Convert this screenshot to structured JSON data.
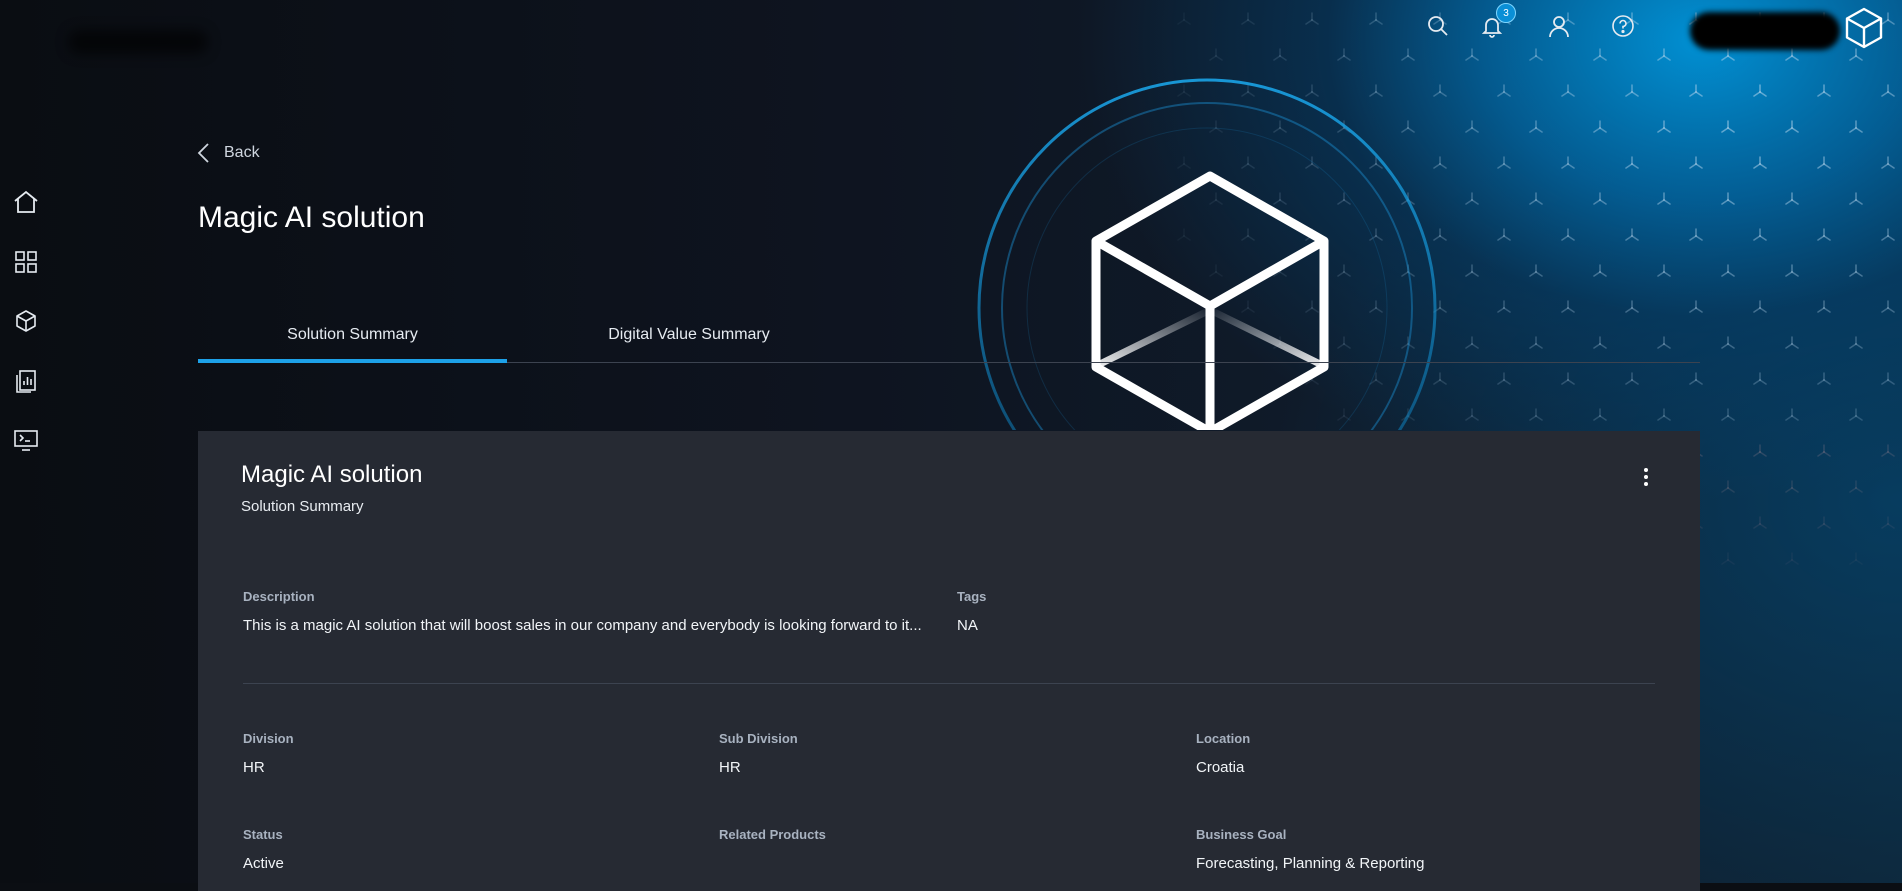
{
  "header": {
    "notification_count": "3",
    "icons": [
      "search-icon",
      "bell-icon",
      "user-icon",
      "help-icon",
      "cube-logo-icon"
    ]
  },
  "sidebar": {
    "items": [
      {
        "icon": "home-icon"
      },
      {
        "icon": "grid-icon"
      },
      {
        "icon": "cube-icon"
      },
      {
        "icon": "report-icon"
      },
      {
        "icon": "terminal-icon"
      }
    ]
  },
  "nav": {
    "back_label": "Back"
  },
  "page": {
    "title": "Magic AI solution"
  },
  "tabs": [
    {
      "label": "Solution Summary",
      "active": true
    },
    {
      "label": "Digital Value Summary",
      "active": false
    }
  ],
  "card": {
    "title": "Magic AI solution",
    "subtitle": "Solution Summary",
    "description": {
      "label": "Description",
      "value": "This is a magic AI solution that will boost sales in our company and everybody is looking forward to it..."
    },
    "tags": {
      "label": "Tags",
      "value": "NA"
    },
    "division": {
      "label": "Division",
      "value": "HR"
    },
    "sub_division": {
      "label": "Sub Division",
      "value": "HR"
    },
    "location": {
      "label": "Location",
      "value": "Croatia"
    },
    "status": {
      "label": "Status",
      "value": "Active"
    },
    "related_products": {
      "label": "Related Products",
      "value": ""
    },
    "business_goal": {
      "label": "Business Goal",
      "value": "Forecasting, Planning & Reporting"
    }
  },
  "colors": {
    "accent": "#1da1e8",
    "card_bg": "#262a33",
    "page_bg": "#0b0e13"
  }
}
